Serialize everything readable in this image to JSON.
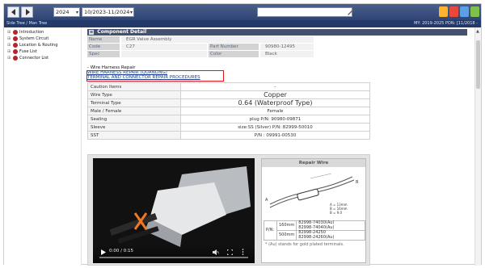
{
  "toolbar": {
    "year_select": "2024",
    "date_select": "10/2023-11/2024",
    "search_value": ""
  },
  "subheader": {
    "left": "Side Tree / Man Tree",
    "right": "MY: 2019-2025 PON: [11/2018 -"
  },
  "sidebar": {
    "items": [
      {
        "label": "Introduction"
      },
      {
        "label": "System Circuit"
      },
      {
        "label": "Location & Routing"
      },
      {
        "label": "Fuse List"
      },
      {
        "label": "Connector List"
      }
    ]
  },
  "component": {
    "title_tag": "≡",
    "title": "Component Detail",
    "name_label": "Name",
    "name_value": "EGR Valve Assembly",
    "code_label": "Code",
    "code_value": "C27",
    "part_label": "Part Number",
    "part_value": "90980-12495",
    "spec_label": "Spec",
    "spec_value": "",
    "color_label": "Color",
    "color_value": "Black"
  },
  "wire_harness": {
    "heading": "- Wire Harness Repair",
    "link1": "WIRE HARNESS REPAIR (QUANLING)",
    "link2": "TERMINAL AND CONNECTOR REPAIR PROCEDURES"
  },
  "spec_rows": [
    {
      "key": "Caution Items",
      "value": "-"
    },
    {
      "key": "Wire Type",
      "value": "Copper"
    },
    {
      "key": "Terminal Type",
      "value": "0.64 (Waterproof Type)"
    },
    {
      "key": "Male / Female",
      "value": "Female"
    },
    {
      "key": "Sealing",
      "value": "plug P/N: 90980-09871"
    },
    {
      "key": "Sleeve",
      "value": "size:SS (Silver) P/N: 82999-50010"
    },
    {
      "key": "SST",
      "value": "P/N : 09991-00530"
    }
  ],
  "video": {
    "time": "0:00 / 0:15"
  },
  "repair_wire": {
    "title": "Repair Wire",
    "dims": "A = 13mm\nB = 16mm\nB = 9.0",
    "pn_label": "P/N:",
    "rows": [
      {
        "len": "160mm",
        "pn": "82998-74030(Au)\n82998-74040(Au)"
      },
      {
        "len": "500mm",
        "pn": "82998-24250\n82998-24260(Au)"
      }
    ],
    "note": "* (Au) stands for gold plated terminals."
  },
  "colors": {
    "toolbar": "#34497a",
    "highlight": "#e0121b",
    "panel_title": "#44516e"
  }
}
